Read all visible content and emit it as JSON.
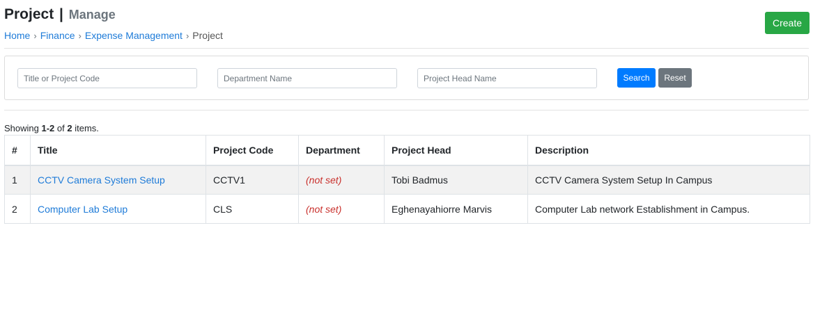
{
  "header": {
    "title": "Project",
    "separator": "|",
    "subtitle": "Manage",
    "create_label": "Create"
  },
  "breadcrumb": {
    "items": [
      "Home",
      "Finance",
      "Expense Management"
    ],
    "current": "Project",
    "separator": "›"
  },
  "filters": {
    "title_placeholder": "Title or Project Code",
    "department_placeholder": "Department Name",
    "head_placeholder": "Project Head Name",
    "search_label": "Search",
    "reset_label": "Reset"
  },
  "summary": {
    "prefix": "Showing",
    "range": "1-2",
    "of": "of",
    "total": "2",
    "suffix": "items."
  },
  "table": {
    "columns": [
      "#",
      "Title",
      "Project Code",
      "Department",
      "Project Head",
      "Description"
    ],
    "rows": [
      {
        "num": "1",
        "title": "CCTV Camera System Setup",
        "code": "CCTV1",
        "department": "(not set)",
        "head": "Tobi Badmus",
        "description": "CCTV Camera System Setup In Campus"
      },
      {
        "num": "2",
        "title": "Computer Lab Setup",
        "code": "CLS",
        "department": "(not set)",
        "head": "Eghenayahiorre Marvis",
        "description": "Computer Lab network Establishment in Campus."
      }
    ]
  },
  "colors": {
    "primary": "#007bff",
    "success": "#28a745",
    "secondary": "#6c757d",
    "link": "#1e7bd8",
    "not_set": "#c9302c"
  }
}
